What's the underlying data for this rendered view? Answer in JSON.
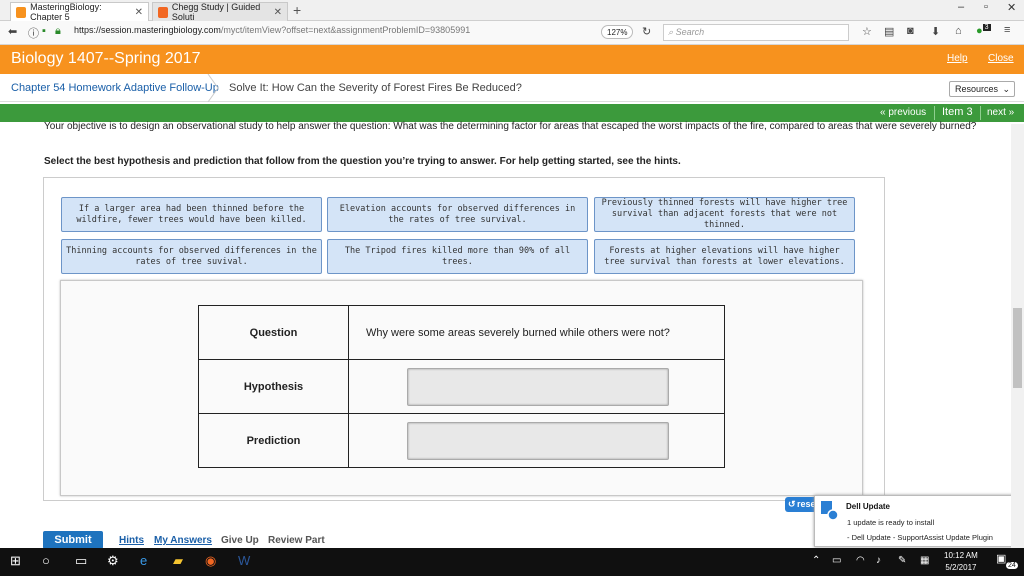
{
  "browser": {
    "tabs": [
      {
        "label": "MasteringBiology: Chapter 5",
        "active": true
      },
      {
        "label": "Chegg Study | Guided Soluti",
        "active": false
      }
    ],
    "url_host": "https://session.masteringbiology.com",
    "url_path": "/myct/itemView?offset=next&assignmentProblemID=93805991",
    "zoom": "127%",
    "search_placeholder": "Search",
    "ext_badge": "3"
  },
  "app": {
    "title": "Biology 1407--Spring 2017",
    "help": "Help",
    "close": "Close",
    "colors": {
      "header": "#f7921e",
      "nav": "#3c9a3c",
      "link": "#1a5fa8"
    }
  },
  "breadcrumb": {
    "assignment": "Chapter 54 Homework Adaptive Follow-Up",
    "item": "Solve It: How Can the Severity of Forest Fires Be Reduced?",
    "resources": "Resources"
  },
  "nav": {
    "previous": "« previous",
    "item": "Item 3",
    "next": "next »"
  },
  "content": {
    "objective": "Your objective is to design an observational study to help answer the question: What was the determining factor for areas that escaped the worst impacts of the fire, compared to areas that were severely burned?",
    "instruction": "Select the best hypothesis and prediction that follow from the question you’re trying to answer. For help getting started, see the hints.",
    "labels": [
      "If a larger area had been thinned before the wildfire, fewer trees would have been killed.",
      "Elevation accounts for observed differences in the rates of tree survival.",
      "Previously thinned forests will have higher tree survival than adjacent forests that were not thinned.",
      "Thinning accounts for observed differences in the rates of tree suvival.",
      "The Tripod fires killed more than 90% of all trees.",
      "Forests at higher elevations will have higher tree survival than forests at lower elevations."
    ],
    "table": {
      "question_label": "Question",
      "question_text": "Why were some areas severely burned while others were not?",
      "hypothesis_label": "Hypothesis",
      "prediction_label": "Prediction"
    },
    "reset": "reset"
  },
  "footer": {
    "submit": "Submit",
    "hints": "Hints",
    "my_answers": "My Answers",
    "give_up": "Give Up",
    "review_part": "Review Part"
  },
  "dell": {
    "title": "Dell Update",
    "line1": "1 update is ready to install",
    "line2": "- Dell Update - SupportAssist Update Plugin"
  },
  "taskbar": {
    "time": "10:12 AM",
    "date": "5/2/2017",
    "notif_count": "24"
  }
}
